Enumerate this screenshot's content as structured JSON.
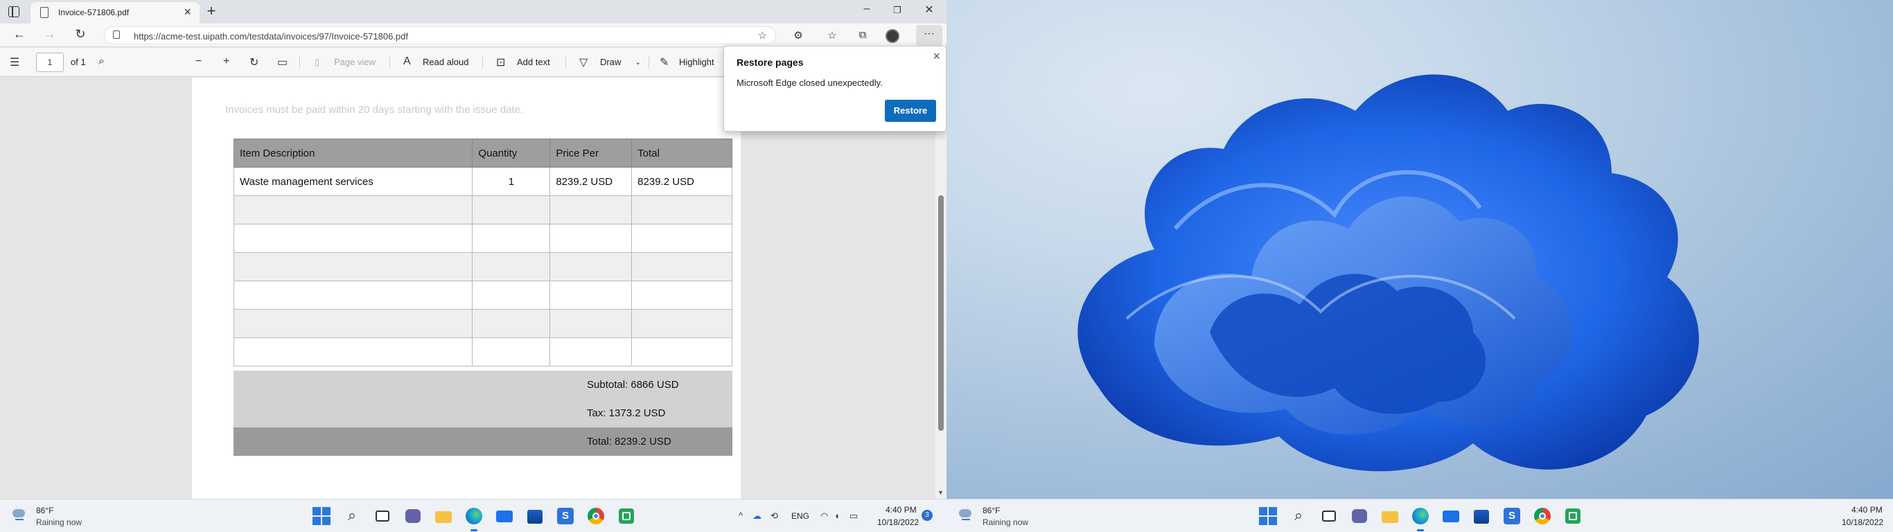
{
  "left_screen": {
    "browser": {
      "tab_title": "Invoice-571806.pdf",
      "url": "https://acme-test.uipath.com/testdata/invoices/97/Invoice-571806.pdf"
    },
    "pdf_toolbar": {
      "page_input_value": "1",
      "page_total": "of 1",
      "page_view_label": "Page view",
      "read_aloud_label": "Read aloud",
      "add_text_label": "Add text",
      "draw_label": "Draw",
      "highlight_label": "Highlight"
    },
    "invoice": {
      "terms": "Invoices must be paid within 20 days starting with the issue date.",
      "columns": [
        "Item Description",
        "Quantity",
        "Price Per",
        "Total"
      ],
      "rows": [
        {
          "description": "Waste management services",
          "quantity": "1",
          "price_per": "8239.2 USD",
          "total": "8239.2 USD"
        },
        {
          "description": "",
          "quantity": "",
          "price_per": "",
          "total": ""
        },
        {
          "description": "",
          "quantity": "",
          "price_per": "",
          "total": ""
        },
        {
          "description": "",
          "quantity": "",
          "price_per": "",
          "total": ""
        },
        {
          "description": "",
          "quantity": "",
          "price_per": "",
          "total": ""
        },
        {
          "description": "",
          "quantity": "",
          "price_per": "",
          "total": ""
        },
        {
          "description": "",
          "quantity": "",
          "price_per": "",
          "total": ""
        }
      ],
      "subtotal": "Subtotal: 6866 USD",
      "tax": "Tax: 1373.2 USD",
      "total": "Total: 8239.2 USD"
    },
    "popup": {
      "title": "Restore pages",
      "message": "Microsoft Edge closed unexpectedly.",
      "button_label": "Restore"
    },
    "taskbar": {
      "weather_temp": "86°F",
      "weather_desc": "Raining now",
      "language": "ENG",
      "time": "4:40 PM",
      "date": "10/18/2022",
      "notification_count": "3"
    }
  },
  "right_screen": {
    "taskbar": {
      "weather_temp": "86°F",
      "weather_desc": "Raining now",
      "time": "4:40 PM",
      "date": "10/18/2022"
    }
  },
  "colors": {
    "accent": "#0f6cbd",
    "table_header": "#9e9e9e",
    "wallpaper_bloom": "#1f66e6"
  }
}
